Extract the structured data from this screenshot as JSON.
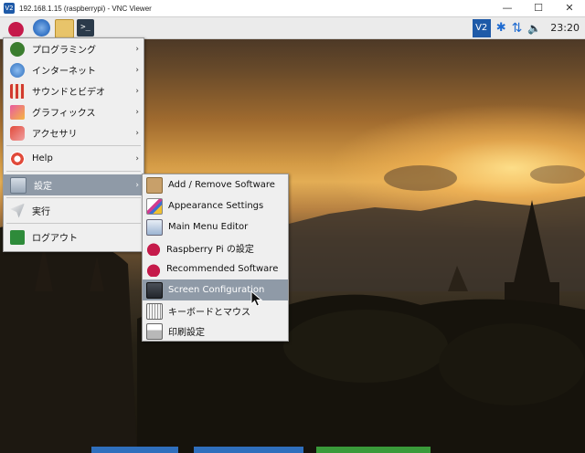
{
  "vnc": {
    "title": "192.168.1.15 (raspberrypi) - VNC Viewer",
    "minimize": "—",
    "maximize": "☐",
    "close": "✕",
    "app_icon": "V2"
  },
  "taskbar": {
    "icons": [
      "raspberry-menu-icon",
      "browser-icon",
      "file-manager-icon",
      "terminal-icon"
    ],
    "terminal_glyph": ">_",
    "tray": {
      "vnc_label": "V2",
      "bluetooth": "✱",
      "network": "⇅",
      "volume": "🔈",
      "clock": "23:20"
    }
  },
  "main_menu": {
    "items": [
      {
        "label": "プログラミング",
        "icon": "programming-icon",
        "has_submenu": true
      },
      {
        "label": "インターネット",
        "icon": "internet-icon",
        "has_submenu": true
      },
      {
        "label": "サウンドとビデオ",
        "icon": "sound-video-icon",
        "has_submenu": true
      },
      {
        "label": "グラフィックス",
        "icon": "graphics-icon",
        "has_submenu": true
      },
      {
        "label": "アクセサリ",
        "icon": "accessories-icon",
        "has_submenu": true
      },
      {
        "label": "Help",
        "icon": "help-icon",
        "has_submenu": true
      },
      {
        "label": "設定",
        "icon": "settings-icon",
        "has_submenu": true
      },
      {
        "label": "実行",
        "icon": "run-icon",
        "has_submenu": false
      },
      {
        "label": "ログアウト",
        "icon": "logout-icon",
        "has_submenu": false
      }
    ],
    "arrow": "›"
  },
  "settings_submenu": {
    "items": [
      {
        "label": "Add / Remove Software",
        "icon": "package-icon"
      },
      {
        "label": "Appearance Settings",
        "icon": "appearance-icon"
      },
      {
        "label": "Main Menu Editor",
        "icon": "menu-editor-icon"
      },
      {
        "label": "Raspberry Pi の設定",
        "icon": "raspberry-config-icon"
      },
      {
        "label": "Recommended Software",
        "icon": "raspberry-recommended-icon"
      },
      {
        "label": "Screen Configuration",
        "icon": "screen-config-icon"
      },
      {
        "label": "キーボードとマウス",
        "icon": "keyboard-mouse-icon"
      },
      {
        "label": "印刷設定",
        "icon": "printer-icon"
      }
    ]
  },
  "colors": {
    "selection": "#8f9aa7",
    "menu_bg": "#efefef"
  }
}
